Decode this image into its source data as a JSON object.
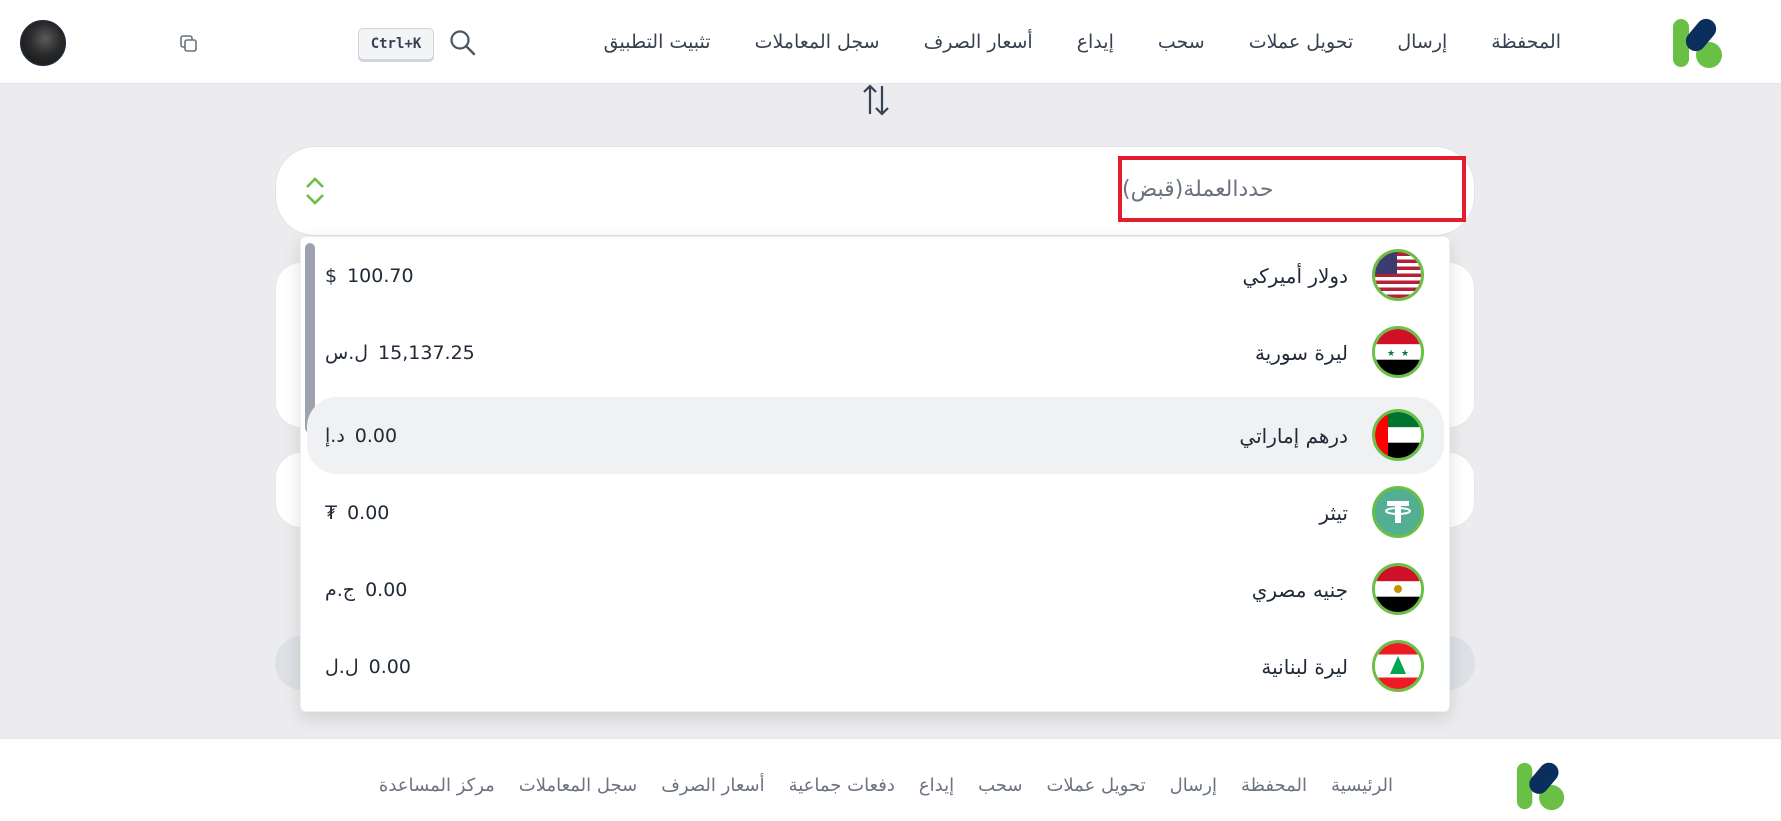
{
  "header": {
    "nav": [
      "المحفظة",
      "إرسال",
      "تحويل عملات",
      "سحب",
      "إيداع",
      "أسعار الصرف",
      "سجل المعاملات",
      "تثبيت التطبيق"
    ],
    "shortcut": "Ctrl+K",
    "icons": [
      "logo",
      "search-icon",
      "copy-icon",
      "avatar"
    ]
  },
  "exchange": {
    "select_label": "حددالعملة(قبض)",
    "currencies": [
      {
        "name": "دولار أميركي",
        "amount": "100.70",
        "symbol": "$",
        "flag": "us"
      },
      {
        "name": "ليرة سورية",
        "amount": "15,137.25",
        "symbol": "ل.س",
        "flag": "sy"
      },
      {
        "name": "درهم إماراتي",
        "amount": "0.00",
        "symbol": "د.إ",
        "flag": "ae"
      },
      {
        "name": "تيثر",
        "amount": "0.00",
        "symbol": "₮",
        "flag": "tether"
      },
      {
        "name": "جنيه مصري",
        "amount": "0.00",
        "symbol": "ج.م",
        "flag": "eg"
      },
      {
        "name": "ليرة لبنانية",
        "amount": "0.00",
        "symbol": "ل.ل",
        "flag": "lb"
      }
    ],
    "highlighted_index": 2
  },
  "footer": {
    "nav": [
      "الرئيسية",
      "المحفظة",
      "إرسال",
      "تحويل عملات",
      "سحب",
      "إيداع",
      "دفعات جماعية",
      "أسعار الصرف",
      "سجل المعاملات",
      "مركز المساعدة"
    ]
  },
  "colors": {
    "brand_green": "#6abf45",
    "brand_navy": "#0b2f5c",
    "highlight_red": "#e11d2e"
  }
}
